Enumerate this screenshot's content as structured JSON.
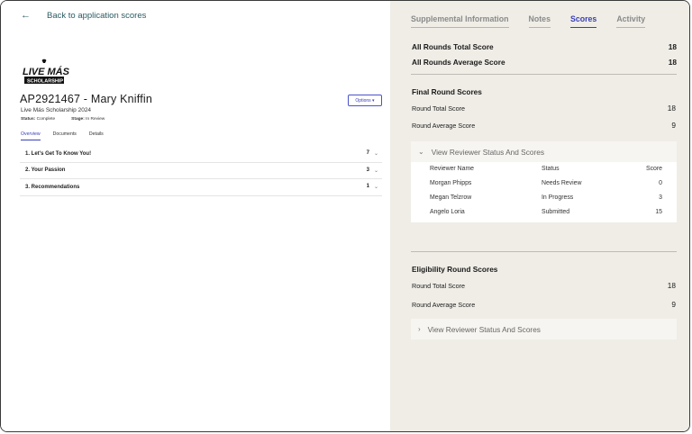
{
  "back": {
    "label": "Back to application scores"
  },
  "logo": {
    "line1": "LIVE MÁS",
    "line2": "SCHOLARSHIP"
  },
  "application": {
    "title": "AP2921467 - Mary Kniffin",
    "program": "Live Más Scholarship 2024",
    "status_label": "Status:",
    "status_value": "Complete",
    "stage_label": "Stage:",
    "stage_value": "In Review",
    "options_label": "Options ▾"
  },
  "left_tabs": [
    "Overview",
    "Documents",
    "Details"
  ],
  "sections": [
    {
      "label": "1.  Let's Get To Know You!",
      "count": "7"
    },
    {
      "label": "2.  Your Passion",
      "count": "3"
    },
    {
      "label": "3.  Recommendations",
      "count": "1"
    }
  ],
  "right_tabs": [
    "Supplemental Information",
    "Notes",
    "Scores",
    "Activity"
  ],
  "active_right_tab": "Scores",
  "totals": [
    {
      "label": "All Rounds Total Score",
      "value": "18"
    },
    {
      "label": "All Rounds Average Score",
      "value": "18"
    }
  ],
  "final_round": {
    "title": "Final Round Scores",
    "total_label": "Round Total Score",
    "total_value": "18",
    "avg_label": "Round Average Score",
    "avg_value": "9",
    "reviewer_toggle": "View Reviewer Status And Scores",
    "columns": [
      "Reviewer Name",
      "Status",
      "Score"
    ],
    "reviewers": [
      {
        "name": "Morgan Phipps",
        "status": "Needs Review",
        "score": "0"
      },
      {
        "name": "Megan Telzrow",
        "status": "In Progress",
        "score": "3"
      },
      {
        "name": "Angelo Loria",
        "status": "Submitted",
        "score": "15"
      }
    ]
  },
  "eligibility_round": {
    "title": "Eligibility Round Scores",
    "total_label": "Round Total Score",
    "total_value": "18",
    "avg_label": "Round Average Score",
    "avg_value": "9",
    "reviewer_toggle": "View Reviewer Status And Scores"
  },
  "colors": {
    "accent": "#3a41b8",
    "right_bg": "#efede6",
    "back_link": "#2b5b63"
  }
}
